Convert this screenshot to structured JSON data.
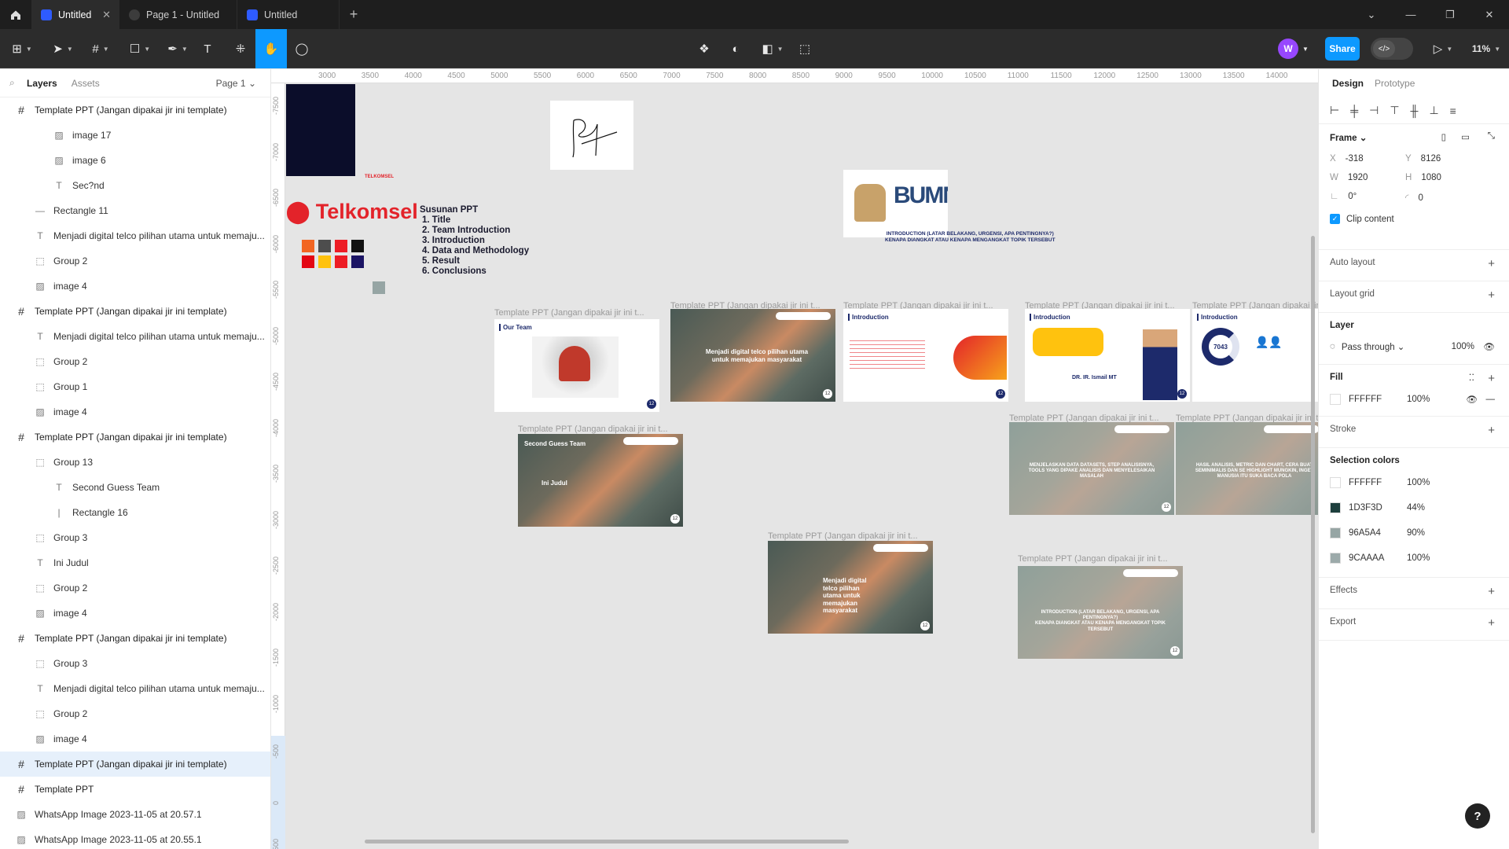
{
  "titlebar": {
    "tabs": [
      {
        "label": "Untitled",
        "active": true
      },
      {
        "label": "Page 1 - Untitled",
        "active": false
      },
      {
        "label": "Untitled",
        "active": false
      }
    ]
  },
  "toolbar": {
    "avatar_initial": "W",
    "share_label": "Share",
    "zoom": "11%"
  },
  "left_panel": {
    "tab_layers": "Layers",
    "tab_assets": "Assets",
    "page": "Page 1",
    "layers": [
      {
        "icon": "frame",
        "indent": 0,
        "label": "Template PPT (Jangan dipakai jir ini template)"
      },
      {
        "icon": "image",
        "indent": 2,
        "label": "image 17"
      },
      {
        "icon": "image",
        "indent": 2,
        "label": "image 6"
      },
      {
        "icon": "text",
        "indent": 2,
        "label": "Sec?nd"
      },
      {
        "icon": "rect",
        "indent": 1,
        "label": "Rectangle 11"
      },
      {
        "icon": "text",
        "indent": 1,
        "label": "Menjadi digital telco pilihan utama untuk memaju..."
      },
      {
        "icon": "group",
        "indent": 1,
        "label": "Group 2"
      },
      {
        "icon": "image",
        "indent": 1,
        "label": "image 4"
      },
      {
        "icon": "frame",
        "indent": 0,
        "label": "Template PPT (Jangan dipakai jir ini template)"
      },
      {
        "icon": "text",
        "indent": 1,
        "label": "Menjadi digital telco pilihan utama untuk memaju..."
      },
      {
        "icon": "group",
        "indent": 1,
        "label": "Group 2"
      },
      {
        "icon": "group",
        "indent": 1,
        "label": "Group 1"
      },
      {
        "icon": "image",
        "indent": 1,
        "label": "image 4"
      },
      {
        "icon": "frame",
        "indent": 0,
        "label": "Template PPT (Jangan dipakai jir ini template)"
      },
      {
        "icon": "group",
        "indent": 1,
        "label": "Group 13"
      },
      {
        "icon": "text",
        "indent": 2,
        "label": "Second Guess Team"
      },
      {
        "icon": "line",
        "indent": 2,
        "label": "Rectangle 16"
      },
      {
        "icon": "group",
        "indent": 1,
        "label": "Group 3"
      },
      {
        "icon": "text",
        "indent": 1,
        "label": "Ini Judul"
      },
      {
        "icon": "group",
        "indent": 1,
        "label": "Group 2"
      },
      {
        "icon": "image",
        "indent": 1,
        "label": "image 4"
      },
      {
        "icon": "frame",
        "indent": 0,
        "label": "Template PPT (Jangan dipakai jir ini template)"
      },
      {
        "icon": "group",
        "indent": 1,
        "label": "Group 3"
      },
      {
        "icon": "text",
        "indent": 1,
        "label": "Menjadi digital telco pilihan utama untuk memaju..."
      },
      {
        "icon": "group",
        "indent": 1,
        "label": "Group 2"
      },
      {
        "icon": "image",
        "indent": 1,
        "label": "image 4"
      },
      {
        "icon": "frame",
        "indent": 0,
        "label": "Template PPT (Jangan dipakai jir ini template)",
        "selected": true
      },
      {
        "icon": "frame",
        "indent": 0,
        "label": "Template PPT"
      },
      {
        "icon": "image",
        "indent": 0,
        "label": "WhatsApp Image 2023-11-05 at 20.57.1"
      },
      {
        "icon": "image",
        "indent": 0,
        "label": "WhatsApp Image 2023-11-05 at 20.55.1"
      }
    ]
  },
  "rulers": {
    "top": [
      "3000",
      "3500",
      "4000",
      "4500",
      "5000",
      "5500",
      "6000",
      "6500",
      "7000",
      "7500",
      "8000",
      "8500",
      "9000",
      "9500",
      "10000",
      "10500",
      "11000",
      "11500",
      "12000",
      "12500",
      "13000",
      "13500",
      "14000"
    ],
    "left": [
      "-7500",
      "-7000",
      "-6500",
      "-6000",
      "-5500",
      "-5000",
      "-4500",
      "-4000",
      "-3500",
      "-3000",
      "-2500",
      "-2000",
      "-1500",
      "-1000",
      "-500",
      "0",
      "500"
    ]
  },
  "canvas": {
    "frame_label": "Template PPT (Jangan dipakai jir ini t...",
    "telkomsel": "Telkomsel",
    "telkomsel_small": "TELKOMSEL",
    "susunan_title": "Susunan PPT",
    "susunan_items": [
      "1. Title",
      "2. Team Introduction",
      "3. Introduction",
      "4. Data and Methodology",
      "5. Result",
      "6. Conclusions"
    ],
    "bumn_line1": "INTRODUCTION (LATAR BELAKANG, URGENSI, APA PENTINGNYA?)",
    "bumn_line2": "KENAPA DIANGKAT ATAU KENAPA MENGANGKAT TOPIK TERSEBUT",
    "our_team": "Our Team",
    "tagline": "Menjadi digital telco pilihan utama untuk memajukan masyarakat",
    "introduction": "Introduction",
    "intro_person": "DR. IR. Ismail MT",
    "intro_stat": "7043",
    "slide_datasets": "MENJELASKAN DATA DATASETS, STEP ANALISISNYA, TOOLS YANG DIPAKE ANALISIS DAN MENYELESAIKAN MASALAH",
    "slide_hasil": "HASIL ANALISIS, METRIC DAN CHART, CERA BUAT SEMINIMALIS DAN SE HIGHLIGHT MUNGKIN, INGET MANUSIA ITU SUKA BACA POLA",
    "second_guess": "Second Guess Team",
    "ini_judul": "Ini Judul",
    "page_num": "12",
    "swatch_colors": [
      "#f26522",
      "#4d4d4d",
      "#ed1c24",
      "#111111",
      "#e30613",
      "#ffc20e",
      "#ed1c24",
      "#1b1464"
    ]
  },
  "right_panel": {
    "tab_design": "Design",
    "tab_prototype": "Prototype",
    "frame_label": "Frame",
    "x": "-318",
    "y": "8126",
    "w": "1920",
    "h": "1080",
    "rotation": "0°",
    "radius": "0",
    "clip_content": "Clip content",
    "auto_layout": "Auto layout",
    "layout_grid": "Layout grid",
    "layer_label": "Layer",
    "blend": "Pass through",
    "layer_opacity": "100%",
    "fill_label": "Fill",
    "fill_hex": "FFFFFF",
    "fill_opacity": "100%",
    "stroke_label": "Stroke",
    "selection_colors_label": "Selection colors",
    "selection_colors": [
      {
        "hex": "FFFFFF",
        "opacity": "100%",
        "color": "#FFFFFF"
      },
      {
        "hex": "1D3F3D",
        "opacity": "44%",
        "color": "#1D3F3D"
      },
      {
        "hex": "96A5A4",
        "opacity": "90%",
        "color": "#96A5A4"
      },
      {
        "hex": "9CAAAA",
        "opacity": "100%",
        "color": "#9CAAAA"
      }
    ],
    "effects_label": "Effects",
    "export_label": "Export",
    "help": "?"
  }
}
